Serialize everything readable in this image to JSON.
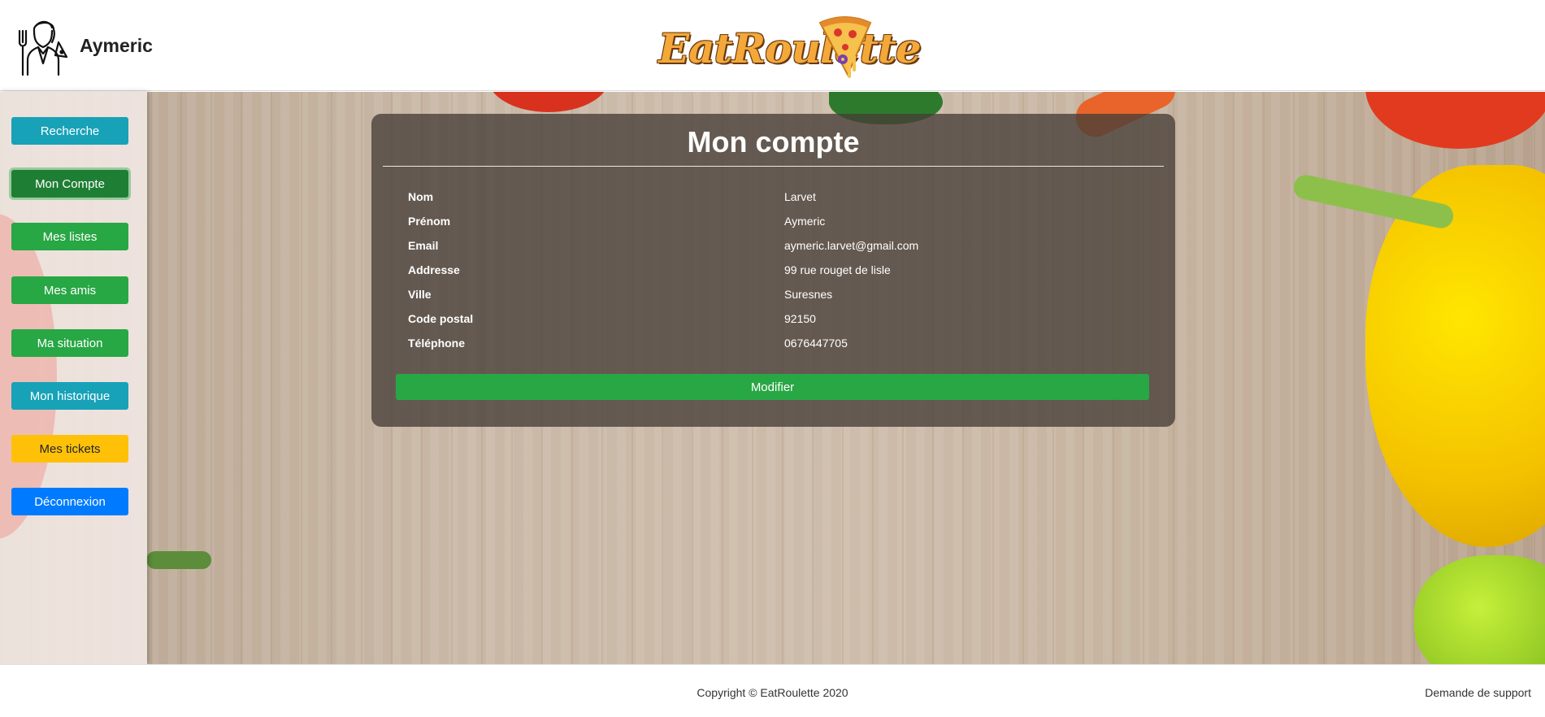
{
  "header": {
    "username": "Aymeric",
    "logo_text": "EatRoulette"
  },
  "sidebar": {
    "items": [
      {
        "label": "Recherche",
        "style": "info"
      },
      {
        "label": "Mon Compte",
        "style": "success-active"
      },
      {
        "label": "Mes listes",
        "style": "success"
      },
      {
        "label": "Mes amis",
        "style": "success"
      },
      {
        "label": "Ma situation",
        "style": "success"
      },
      {
        "label": "Mon historique",
        "style": "info"
      },
      {
        "label": "Mes tickets",
        "style": "warning"
      },
      {
        "label": "Déconnexion",
        "style": "primary"
      }
    ]
  },
  "account": {
    "title": "Mon compte",
    "fields": [
      {
        "label": "Nom",
        "value": "Larvet"
      },
      {
        "label": "Prénom",
        "value": "Aymeric"
      },
      {
        "label": "Email",
        "value": "aymeric.larvet@gmail.com"
      },
      {
        "label": "Addresse",
        "value": "99 rue rouget de lisle"
      },
      {
        "label": "Ville",
        "value": "Suresnes"
      },
      {
        "label": "Code postal",
        "value": "92150"
      },
      {
        "label": "Téléphone",
        "value": "0676447705"
      }
    ],
    "modify_label": "Modifier"
  },
  "footer": {
    "copyright": "Copyright © EatRoulette 2020",
    "support": "Demande de support"
  },
  "colors": {
    "info": "#17a2b8",
    "success": "#28a745",
    "warning": "#ffc107",
    "primary": "#007bff",
    "card_bg": "#463e37"
  }
}
